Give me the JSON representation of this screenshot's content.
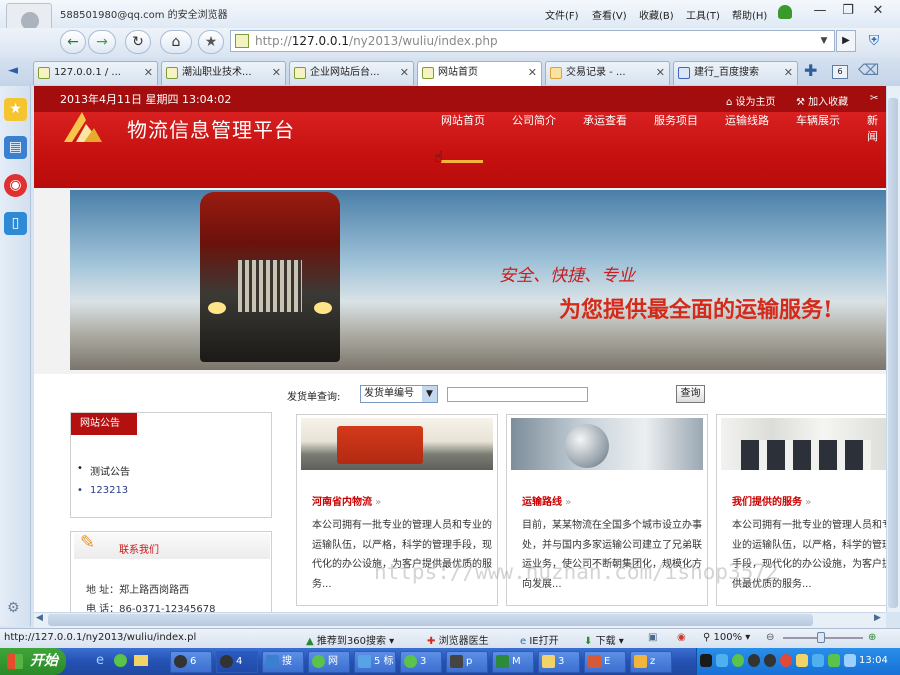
{
  "browser": {
    "title": "588501980@qq.com 的安全浏览器",
    "menus": [
      "文件(F)",
      "查看(V)",
      "收藏(B)",
      "工具(T)",
      "帮助(H)"
    ],
    "window_buttons": [
      "—",
      "❐",
      "✕"
    ],
    "address": {
      "scheme": "http://",
      "host": "127.0.0.1",
      "path": "/ny2013/wuliu/index.php"
    }
  },
  "tabs": [
    {
      "label": "127.0.0.1 / ..."
    },
    {
      "label": "潮汕职业技术..."
    },
    {
      "label": "企业网站后台..."
    },
    {
      "label": "网站首页"
    },
    {
      "label": "交易记录 - ..."
    },
    {
      "label": "建行_百度搜索"
    }
  ],
  "page": {
    "date": "2013年4月11日 星期四 13:04:02",
    "set_home": "设为主页",
    "add_fav": "加入收藏",
    "site_title": "物流信息管理平台",
    "nav": [
      "网站首页",
      "公司简介",
      "承运查看",
      "服务项目",
      "运输线路",
      "车辆展示",
      "新闻"
    ],
    "slogan1": "安全、快捷、专业",
    "slogan2": "为您提供最全面的运输服务!",
    "query": {
      "label": "发货单查询:",
      "select": "发货单编号",
      "button": "查询"
    },
    "notice": {
      "title": "网站公告",
      "items": [
        "测试公告",
        "123213"
      ]
    },
    "contact": {
      "title": "联系我们",
      "address": "地 址：郑上路西岗路西",
      "phone": "电 话：86-0371-12345678"
    },
    "cards": [
      {
        "title": "河南省内物流",
        "text": "本公司拥有一批专业的管理人员和专业的运输队伍，以严格，科学的管理手段，现代化的办公设施，为客户提供最优质的服务..."
      },
      {
        "title": "运输路线",
        "text": "目前，某某物流在全国多个城市设立办事处，并与国内多家运输公司建立了兄弟联运业务，使公司不断朝集团化，规模化方向发展..."
      },
      {
        "title": "我们提供的服务",
        "text": "本公司拥有一批专业的管理人员和专业的运输队伍，以严格，科学的管理手段，现代化的办公设施，为客户提供最优质的服务..."
      }
    ],
    "watermark": "https://www.huzhan.com/ishop3572"
  },
  "statusbar": {
    "url": "http://127.0.0.1/ny2013/wuliu/index.pl",
    "recommend": "推荐到360搜索",
    "doctor": "浏览器医生",
    "ie": "IE打开",
    "download": "下载",
    "zoom": "100%"
  },
  "taskbar": {
    "start": "开始",
    "tasks": [
      "6",
      "4",
      "搜",
      "网",
      "5 标",
      "3",
      "p",
      "M",
      "3",
      "E",
      "z"
    ],
    "clock": "13:04"
  },
  "colors": {
    "brand_red": "#c51010",
    "dark_red": "#a30d0d",
    "taskbar_blue": "#2552b3",
    "start_green": "#3ea53a"
  }
}
